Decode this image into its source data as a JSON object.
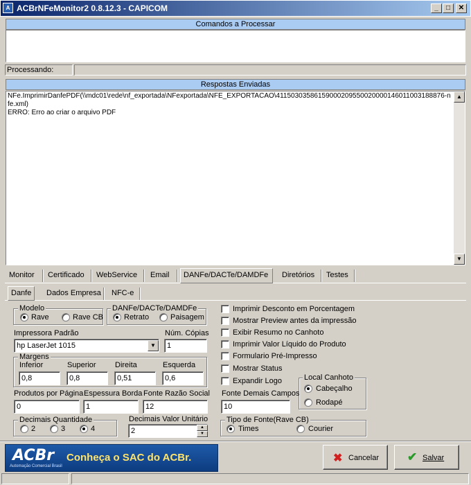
{
  "window": {
    "title": "ACBrNFeMonitor2 0.8.12.3 - CAPICOM"
  },
  "commands_header": "Comandos a Processar",
  "processing_label": "Processando:",
  "responses_header": "Respostas Enviadas",
  "responses_text": "NFe.ImprimirDanfePDF(\\\\mdc01\\rede\\nf_exportada\\NFexportada\\NFE_EXPORTACAO\\41150303586159000209550020000146011003188876-nfe.xml)\nERRO: Erro ao criar o arquivo PDF",
  "main_tabs": [
    "Monitor",
    "Certificado",
    "WebService",
    "Email",
    "DANFe/DACTe/DAMDFe",
    "Diretórios",
    "Testes"
  ],
  "sub_tabs": [
    "Danfe",
    "Dados Empresa",
    "NFC-e"
  ],
  "modelo": {
    "title": "Modelo",
    "options": [
      "Rave",
      "Rave CB"
    ],
    "selected": "Rave"
  },
  "danfe_group": {
    "title": "DANFe/DACTe/DAMDFe",
    "options": [
      "Retrato",
      "Paisagem"
    ],
    "selected": "Retrato"
  },
  "printer": {
    "label": "Impressora Padrão",
    "value": "hp LaserJet 1015"
  },
  "copies": {
    "label": "Núm. Cópias",
    "value": "1"
  },
  "margins": {
    "title": "Margens",
    "fields": [
      {
        "label": "Inferior",
        "value": "0,8"
      },
      {
        "label": "Superior",
        "value": "0,8"
      },
      {
        "label": "Direita",
        "value": "0,51"
      },
      {
        "label": "Esquerda",
        "value": "0,6"
      }
    ]
  },
  "products_per_page": {
    "label": "Produtos por Página",
    "value": "0"
  },
  "border_thickness": {
    "label": "Espessura Borda",
    "value": "1"
  },
  "font_company": {
    "label": "Fonte Razão Social",
    "value": "12"
  },
  "font_other": {
    "label": "Fonte Demais Campos",
    "value": "10"
  },
  "decimals_qty": {
    "title": "Decimais Quantidade",
    "options": [
      "2",
      "3",
      "4"
    ],
    "selected": "4"
  },
  "decimals_unit": {
    "label": "Decimais Valor Unitário",
    "value": "2"
  },
  "checkboxes": [
    "Imprimir Desconto em Porcentagem",
    "Mostrar Preview antes da impressão",
    "Exibir Resumo no Canhoto",
    "Imprimir Valor Líquido do Produto",
    "Formulario Pré-Impresso",
    "Mostrar Status",
    "Expandir Logo"
  ],
  "stub_location": {
    "title": "Local Canhoto",
    "options": [
      "Cabeçalho",
      "Rodapé"
    ],
    "selected": "Cabeçalho"
  },
  "font_type": {
    "title": "Tipo de Fonte(Rave CB)",
    "options": [
      "Times",
      "Courier"
    ],
    "selected": "Times"
  },
  "banner": {
    "logo": "ACBr",
    "logo_sub": "Automação Comercial Brasil",
    "slogan": "Conheça o SAC do ACBr."
  },
  "buttons": {
    "cancel": "Cancelar",
    "save": "Salvar"
  },
  "colors": {
    "titlebar": "#0a246a",
    "header": "#aacbf2",
    "cancel_icon": "#d02020",
    "save_icon": "#2a9a2a"
  }
}
